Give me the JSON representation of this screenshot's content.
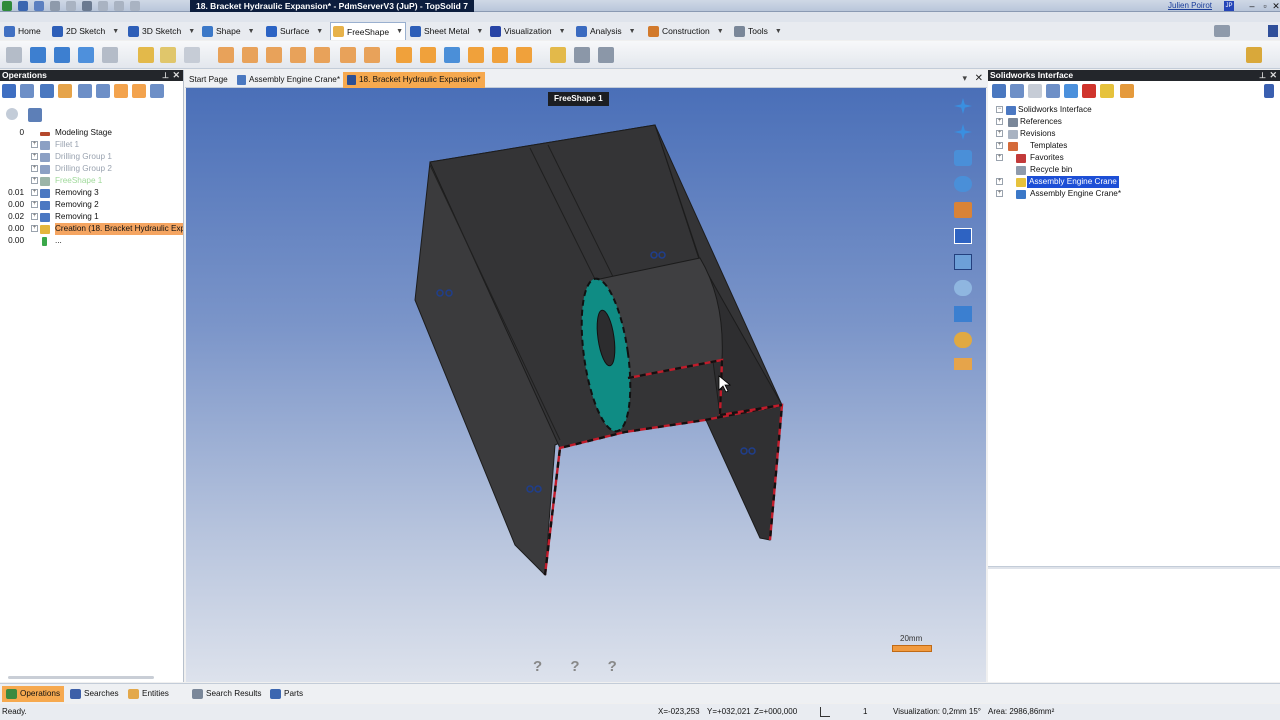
{
  "window": {
    "title": "18. Bracket Hydraulic Expansion* - PdmServerV3 (JuP) - TopSolid 7",
    "user_name": "Julien Poirot",
    "user_initials": "JP"
  },
  "ribbon_tabs": [
    {
      "label": "Home"
    },
    {
      "label": "2D Sketch"
    },
    {
      "label": "3D Sketch"
    },
    {
      "label": "Shape"
    },
    {
      "label": "Surface"
    },
    {
      "label": "FreeShape"
    },
    {
      "label": "Sheet Metal"
    },
    {
      "label": "Visualization"
    },
    {
      "label": "Analysis"
    },
    {
      "label": "Construction"
    },
    {
      "label": "Tools"
    }
  ],
  "left_panel": {
    "title": "Operations",
    "tree": [
      {
        "num": "0",
        "label": "Modeling Stage",
        "state": "normal"
      },
      {
        "num": "",
        "label": "Fillet 1",
        "state": "dim"
      },
      {
        "num": "",
        "label": "Drilling Group 1",
        "state": "dim"
      },
      {
        "num": "",
        "label": "Drilling Group 2",
        "state": "dim"
      },
      {
        "num": "",
        "label": "FreeShape 1",
        "state": "dim-green"
      },
      {
        "num": "0.01",
        "label": "Removing 3",
        "state": "normal"
      },
      {
        "num": "0.00",
        "label": "Removing 2",
        "state": "normal"
      },
      {
        "num": "0.02",
        "label": "Removing 1",
        "state": "normal"
      },
      {
        "num": "0.00",
        "label": "Creation (18. Bracket Hydraulic Expa",
        "state": "selected"
      },
      {
        "num": "0.00",
        "label": "...",
        "state": "normal"
      }
    ]
  },
  "document_tabs": [
    {
      "label": "Start Page",
      "active": false
    },
    {
      "label": "Assembly Engine Crane*",
      "active": false
    },
    {
      "label": "18. Bracket Hydraulic Expansion*",
      "active": true
    }
  ],
  "viewport": {
    "operation_label": "FreeShape 1",
    "scale_label": "20mm",
    "help_marks": "? ? ?"
  },
  "right_panel": {
    "title": "Solidworks Interface",
    "tree": [
      {
        "label": "Solidworks Interface",
        "level": 0
      },
      {
        "label": "References",
        "level": 1
      },
      {
        "label": "Revisions",
        "level": 1
      },
      {
        "label": "Templates",
        "level": 1
      },
      {
        "label": "Favorites",
        "level": 1
      },
      {
        "label": "Recycle bin",
        "level": 1
      },
      {
        "label": "Assembly Engine Crane",
        "level": 1,
        "selected": true
      },
      {
        "label": "Assembly Engine Crane*",
        "level": 1
      }
    ]
  },
  "bottom_tabs": [
    {
      "label": "Operations",
      "active": true
    },
    {
      "label": "Searches",
      "active": false
    },
    {
      "label": "Entities",
      "active": false
    },
    {
      "label": "Search Results",
      "active": false
    },
    {
      "label": "Parts",
      "active": false
    }
  ],
  "status": {
    "ready": "Ready.",
    "x": "X=-023,253",
    "y": "Y=+032,021",
    "z": "Z=+000,000",
    "count": "1",
    "visualization": "Visualization: 0,2mm 15°",
    "area": "Area: 2986,86mm²"
  },
  "colors": {
    "accent_orange": "#f6a94f",
    "selection_blue": "#1d4fd6",
    "dark_header": "#23262b",
    "model_face": "#3a3a3c",
    "selected_face": "#0f8c84",
    "edge_highlight": "#c21b2a"
  }
}
